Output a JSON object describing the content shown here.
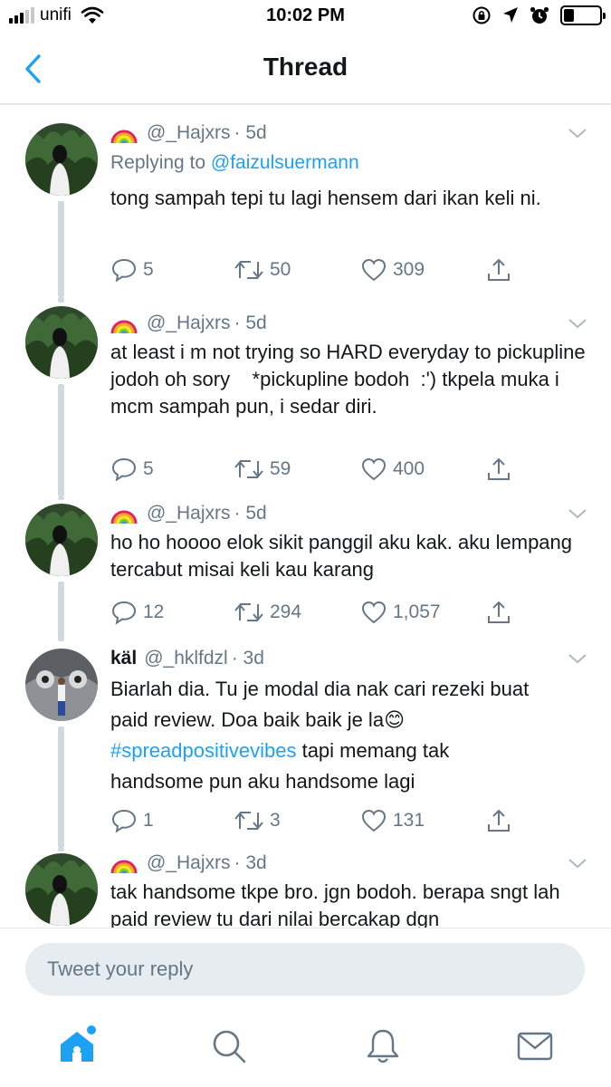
{
  "status_bar": {
    "carrier": "unifi",
    "time": "10:02 PM",
    "battery_level": 0.3,
    "icons": [
      "signal-icon",
      "wifi-icon",
      "rotation-lock-icon",
      "location-icon",
      "alarm-icon",
      "battery-icon"
    ]
  },
  "header": {
    "title": "Thread",
    "back_icon": "back-chevron-icon"
  },
  "colors": {
    "accent": "#1da1f2",
    "text": "#14171a",
    "muted": "#657786",
    "divider": "#e1e8ed",
    "input_bg": "#e6ecf0"
  },
  "tweets": [
    {
      "name": "",
      "handle": "@_Hajxrs",
      "time": "· 5d",
      "reply_to_prefix": "Replying to ",
      "reply_to_handle": "@faizulsuermann",
      "text": "tong sampah tepi tu lagi hensem dari ikan keli ni.",
      "replies": "5",
      "retweets": "50",
      "likes": "309"
    },
    {
      "name": "",
      "handle": "@_Hajxrs",
      "time": "· 5d",
      "text": "at least i m not trying so HARD everyday to pickupline jodoh oh sory    *pickupline bodoh  :') tkpela muka i mcm sampah pun, i sedar diri.",
      "replies": "5",
      "retweets": "59",
      "likes": "400"
    },
    {
      "name": "",
      "handle": "@_Hajxrs",
      "time": "· 5d",
      "text": "ho ho hoooo elok sikit panggil aku kak. aku lempang tercabut misai keli kau karang",
      "replies": "12",
      "retweets": "294",
      "likes": "1,057"
    },
    {
      "name": "käl",
      "handle": "@_hklfdzl",
      "time": "· 3d",
      "text_line1": "Biarlah dia. Tu je modal dia nak cari rezeki buat",
      "text_line2": "paid review. Doa baik baik je la",
      "emoji": "😊",
      "hashtag": "#spreadpositivevibes",
      "text_after_hashtag": " tapi memang tak",
      "text_line4": "handsome pun aku handsome lagi",
      "replies": "1",
      "retweets": "3",
      "likes": "131"
    },
    {
      "name": "",
      "handle": "@_Hajxrs",
      "time": "· 3d",
      "text": "tak handsome tkpe bro. jgn bodoh. berapa sngt lah paid review tu dari nilai bercakap dgn"
    }
  ],
  "reply_box": {
    "placeholder": "Tweet your reply"
  },
  "tabs": [
    "home-icon",
    "search-icon",
    "notifications-icon",
    "messages-icon"
  ]
}
